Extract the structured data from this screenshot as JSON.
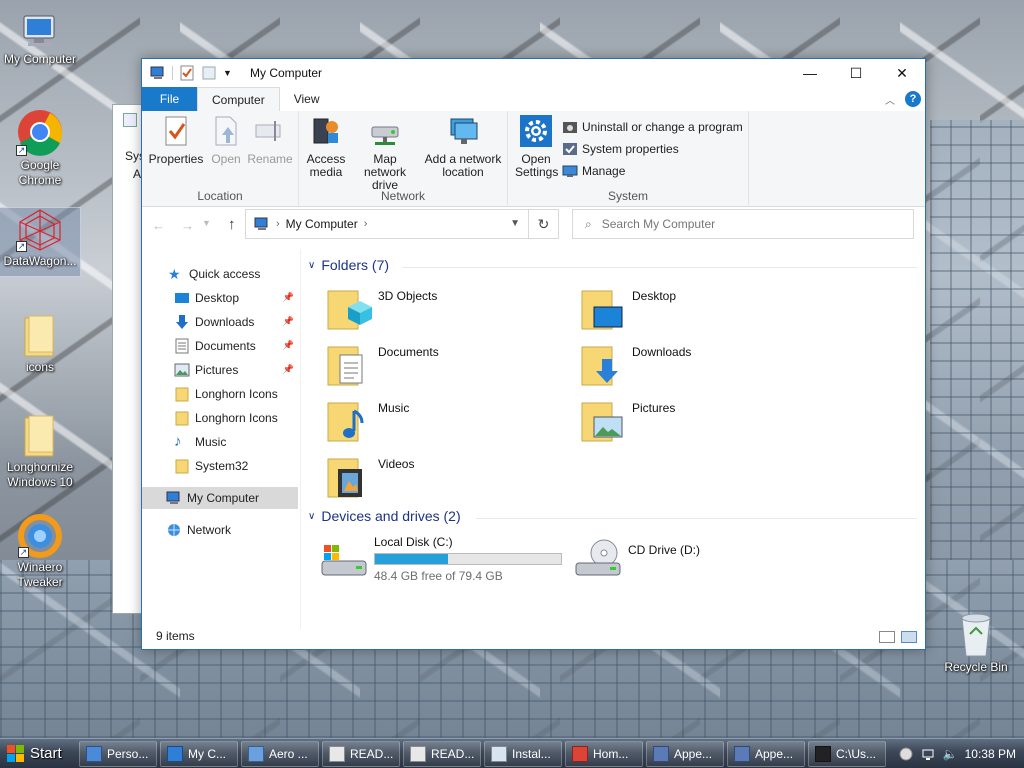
{
  "desktop": {
    "icons": [
      {
        "label": "My Computer",
        "icon": "computer-icon"
      },
      {
        "label": "Google Chrome",
        "icon": "chrome-icon"
      },
      {
        "label": "DataWagon...",
        "icon": "datawagon-icon"
      },
      {
        "label": "icons",
        "icon": "folder-icon"
      },
      {
        "label": "Longhornize Windows 10",
        "icon": "folder-icon"
      },
      {
        "label": "Winaero Tweaker",
        "icon": "winaero-icon"
      },
      {
        "label": "Recycle Bin",
        "icon": "recycle-bin-icon"
      }
    ],
    "background_window": {
      "line1": "Sys",
      "line2": "A"
    }
  },
  "window": {
    "title": "My Computer",
    "caption": {
      "minimize": "—",
      "maximize": "☐",
      "close": "✕"
    },
    "ribbon_tabs": [
      "File",
      "Computer",
      "View"
    ],
    "help": "?",
    "ribbon": {
      "location": {
        "label": "Location",
        "buttons": [
          "Properties",
          "Open",
          "Rename"
        ]
      },
      "network": {
        "label": "Network",
        "access_media": "Access media",
        "map_drive": "Map network drive",
        "add_location": "Add a network location"
      },
      "system": {
        "label": "System",
        "open_settings": "Open Settings",
        "uninstall": "Uninstall or change a program",
        "system_properties": "System properties",
        "manage": "Manage"
      }
    },
    "address": {
      "path": "My Computer",
      "search_placeholder": "Search My Computer"
    },
    "nav": {
      "quick_access": "Quick access",
      "pinned": [
        {
          "label": "Desktop",
          "pinned": true
        },
        {
          "label": "Downloads",
          "pinned": true
        },
        {
          "label": "Documents",
          "pinned": true
        },
        {
          "label": "Pictures",
          "pinned": true
        },
        {
          "label": "Longhorn Icons",
          "pinned": false
        },
        {
          "label": "Longhorn Icons",
          "pinned": false
        },
        {
          "label": "Music",
          "pinned": false
        },
        {
          "label": "System32",
          "pinned": false
        }
      ],
      "my_computer": "My Computer",
      "network": "Network"
    },
    "folders_header": "Folders (7)",
    "folders": [
      "3D Objects",
      "Desktop",
      "Documents",
      "Downloads",
      "Music",
      "Pictures",
      "Videos"
    ],
    "devices_header": "Devices and drives (2)",
    "drives": [
      {
        "name": "Local Disk (C:)",
        "free_text": "48.4 GB free of 79.4 GB",
        "used_fraction": 0.39
      },
      {
        "name": "CD Drive (D:)"
      }
    ],
    "status": "9 items"
  },
  "taskbar": {
    "start": "Start",
    "items": [
      "Perso...",
      "My C...",
      "Aero ...",
      "READ...",
      "READ...",
      "Instal...",
      "Hom...",
      "Appe...",
      "Appe...",
      "C:\\Us..."
    ],
    "clock": "10:38 PM"
  },
  "colors": {
    "accent": "#1979ca",
    "drive_bar": "#26a0da",
    "group_header": "#1e3287"
  }
}
